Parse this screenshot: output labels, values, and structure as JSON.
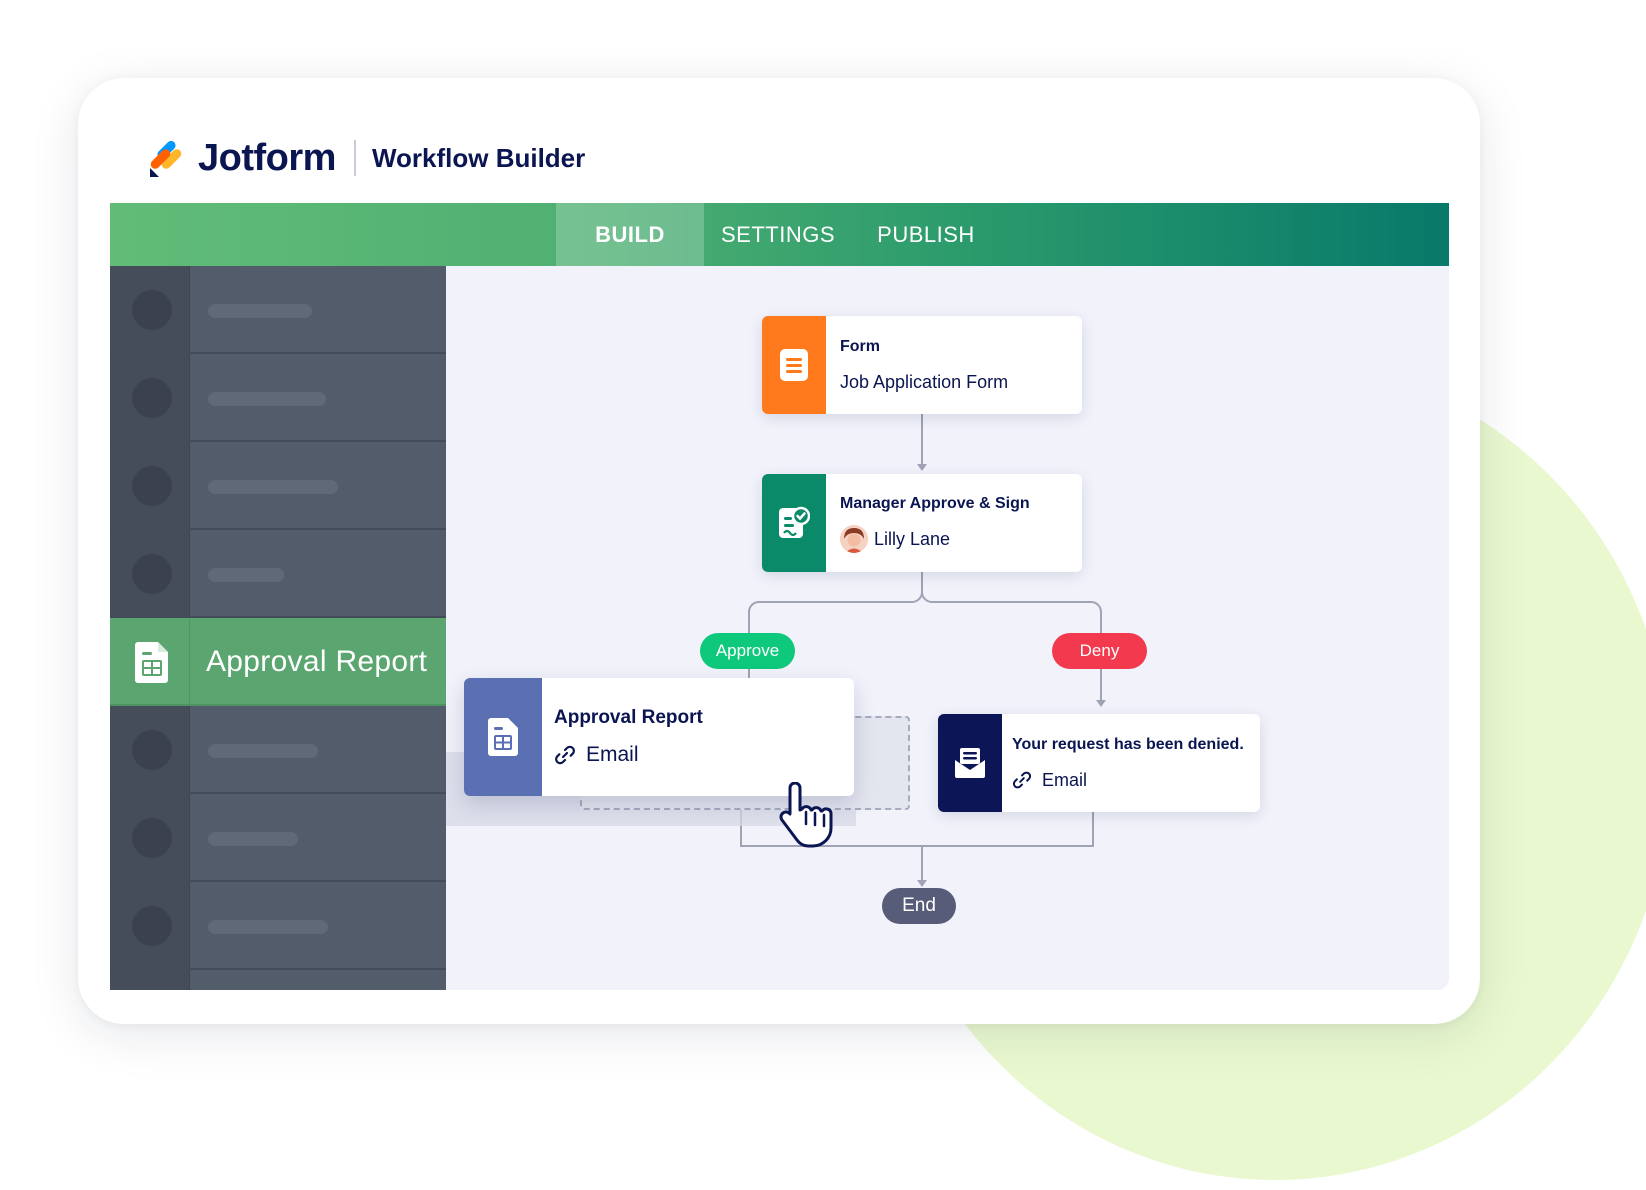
{
  "header": {
    "brand": "Jotform",
    "product": "Workflow Builder"
  },
  "nav": {
    "tabs": [
      {
        "label": "BUILD",
        "active": true
      },
      {
        "label": "SETTINGS",
        "active": false
      },
      {
        "label": "PUBLISH",
        "active": false
      }
    ]
  },
  "sidebar": {
    "active_item": "Approval Report"
  },
  "workflow": {
    "form": {
      "title": "Form",
      "subtitle": "Job Application Form"
    },
    "manager": {
      "title": "Manager Approve & Sign",
      "assignee": "Lilly Lane"
    },
    "approve_label": "Approve",
    "deny_label": "Deny",
    "report": {
      "title": "Approval Report",
      "subtitle": "Email"
    },
    "denied": {
      "title": "Your request has been denied.",
      "subtitle": "Email"
    },
    "end_label": "End"
  },
  "colors": {
    "navy": "#0a1551",
    "form_orange": "#ff7a1c",
    "approval_green": "#0b8a6a",
    "report_blue": "#5b6fb3",
    "approve_pill": "#0ec87c",
    "deny_pill": "#f2394e",
    "end_pill": "#575d78"
  }
}
